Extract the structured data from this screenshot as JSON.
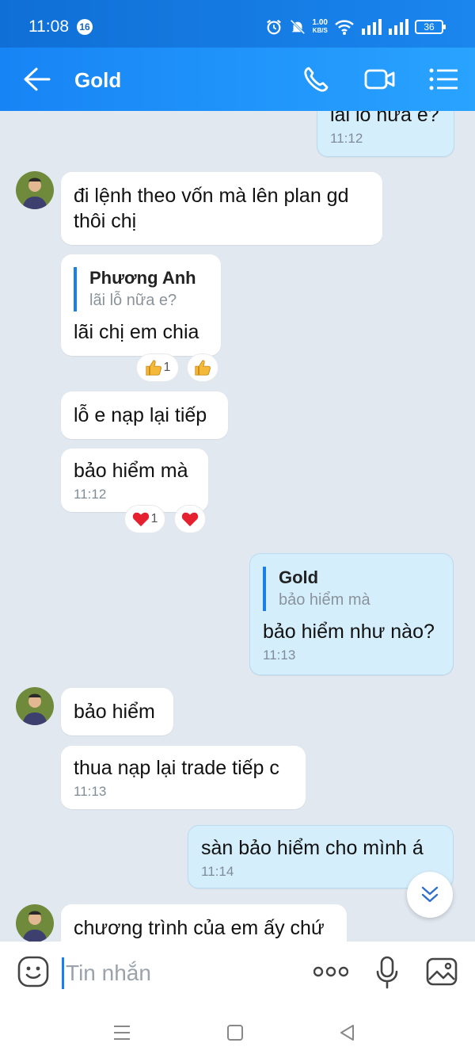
{
  "status_bar": {
    "time": "11:08",
    "notification_count": "16",
    "net_speed_value": "1.00",
    "net_speed_unit": "KB/S",
    "battery": "36"
  },
  "header": {
    "title": "Gold",
    "icons": [
      "back-arrow-icon",
      "phone-icon",
      "video-call-icon",
      "menu-list-icon"
    ]
  },
  "messages": [
    {
      "side": "me",
      "text": "lãi lỗ nữa e?",
      "time": "11:12"
    },
    {
      "side": "other",
      "text": "đi lệnh theo vốn mà lên plan gd thôi chị"
    },
    {
      "side": "other",
      "quote_name": "Phương Anh",
      "quote_text": "lãi lỗ nữa e?",
      "text": "lãi chị em chia",
      "reaction": {
        "icon": "thumbs-up-icon",
        "count": "1"
      }
    },
    {
      "side": "other",
      "text": "lỗ e nạp lại tiếp"
    },
    {
      "side": "other",
      "text": "bảo hiểm mà",
      "time": "11:12",
      "reaction": {
        "icon": "heart-icon",
        "count": "1"
      }
    },
    {
      "side": "me",
      "quote_name": "Gold",
      "quote_text": "bảo hiểm mà",
      "text": "bảo hiểm như nào?",
      "time": "11:13"
    },
    {
      "side": "other",
      "text": "bảo hiểm"
    },
    {
      "side": "other",
      "text": "thua nạp lại trade tiếp c",
      "time": "11:13"
    },
    {
      "side": "me",
      "text": "sàn bảo hiểm  cho mình á",
      "time": "11:14"
    },
    {
      "side": "other",
      "text": "chương trình của em ấy chứ"
    }
  ],
  "composer": {
    "placeholder": "Tin nhắn",
    "icons": [
      "emoji-icon",
      "more-icon",
      "microphone-icon",
      "image-icon"
    ]
  },
  "nav_bar": {
    "icons": [
      "recent-apps-icon",
      "home-icon",
      "back-icon"
    ]
  },
  "colors": {
    "header": "#1a86ee",
    "chat_bg": "#e2e8f0",
    "my_bubble": "#d5eefc",
    "quote_bar": "#1a7fe8"
  }
}
